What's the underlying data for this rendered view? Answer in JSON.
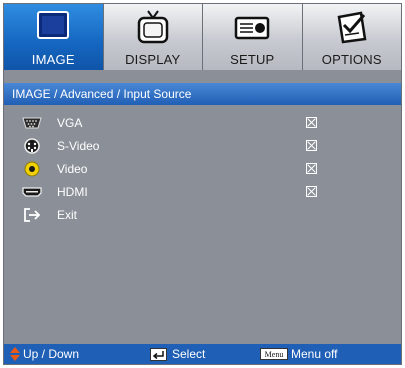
{
  "tabs": [
    {
      "label": "IMAGE",
      "icon": "monitor-icon",
      "active": true
    },
    {
      "label": "DISPLAY",
      "icon": "tv-icon",
      "active": false
    },
    {
      "label": "SETUP",
      "icon": "projector-icon",
      "active": false
    },
    {
      "label": "OPTIONS",
      "icon": "options-check-icon",
      "active": false
    }
  ],
  "header": {
    "title": "IMAGE / Advanced / Input Source"
  },
  "items": [
    {
      "label": "VGA",
      "icon": "vga-port-icon",
      "checked": true
    },
    {
      "label": "S-Video",
      "icon": "svideo-port-icon",
      "checked": true
    },
    {
      "label": "Video",
      "icon": "video-rca-icon",
      "checked": true
    },
    {
      "label": "HDMI",
      "icon": "hdmi-port-icon",
      "checked": true
    },
    {
      "label": "Exit",
      "icon": "exit-icon"
    }
  ],
  "footer": {
    "up_down": "Up / Down",
    "select": "Select",
    "menu_key": "Menu",
    "menu_off": "Menu off"
  },
  "colors": {
    "panel": "#8b9098",
    "accent": "#1f5fb5",
    "active_tab": "#1566c0",
    "arrow": "#e85a18",
    "video_icon": "#f0d000"
  }
}
